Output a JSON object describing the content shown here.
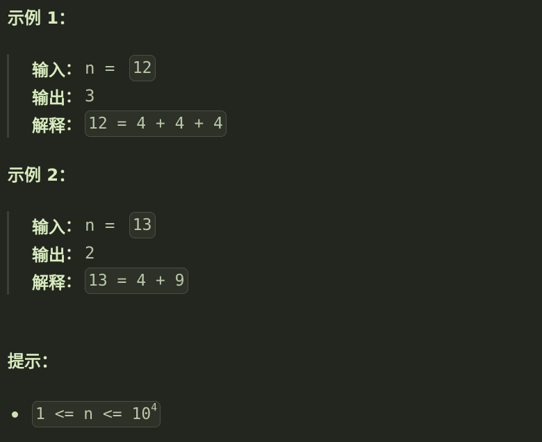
{
  "examples": [
    {
      "heading": "示例 1：",
      "input_label": "输入",
      "input_prefix": "n = ",
      "input_value": "12",
      "output_label": "输出",
      "output_value": "3",
      "explain_label": "解释",
      "explain_value": "12 = 4 + 4 + 4"
    },
    {
      "heading": "示例 2：",
      "input_label": "输入",
      "input_prefix": "n = ",
      "input_value": "13",
      "output_label": "输出",
      "output_value": "2",
      "explain_label": "解释",
      "explain_value": "13 = 4 + 9"
    }
  ],
  "colon": "：",
  "hints": {
    "heading": "提示：",
    "items": [
      {
        "base": "1 <= n <= 10",
        "exponent": "4"
      }
    ]
  },
  "colors": {
    "background": "#23261f",
    "text": "#cfe2b7",
    "code_background": "#2d3128",
    "code_border": "#4a5043",
    "quote_border": "#3b4036"
  }
}
